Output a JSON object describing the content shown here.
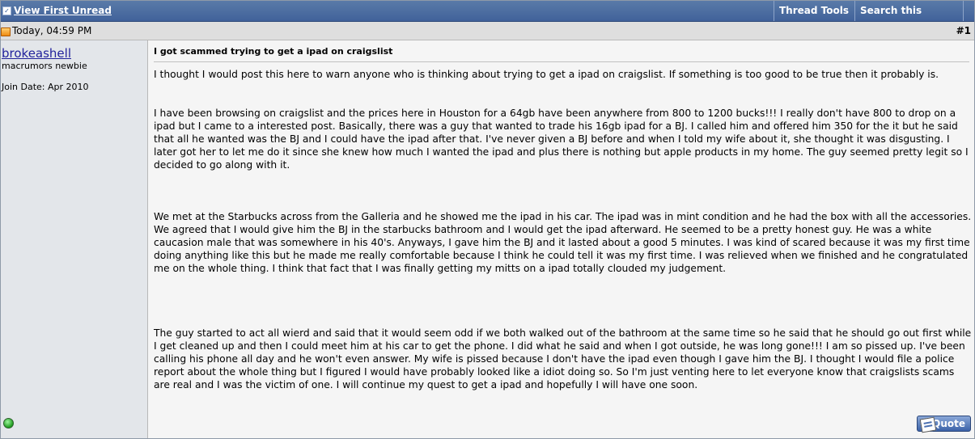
{
  "toolbar": {
    "view_first_unread": "View First Unread",
    "thread_tools": "Thread Tools",
    "search_thread": "Search this Thread"
  },
  "post_header": {
    "date": "Today, 04:59 PM",
    "post_number": "#1"
  },
  "user": {
    "username": "brokeashell",
    "title": "macrumors newbie",
    "join_date": "Join Date: Apr 2010"
  },
  "post": {
    "title": "I got scammed trying to get a ipad on craigslist",
    "paragraphs": [
      "I thought I would post this here to warn anyone who is thinking about trying to get a ipad on craigslist. If something is too good to be true then it probably is.",
      "I have been browsing on craigslist and the prices here in Houston for a 64gb have been anywhere from 800 to 1200 bucks!!! I really don't have 800 to drop on a ipad but I came to a interested post. Basically, there was a guy that wanted to trade his 16gb ipad for a BJ. I called him and offered him 350 for the it but he said that all he wanted was the BJ and I could have the ipad after that. I've never given a BJ before and when I told my wife about it, she thought it was disgusting. I later got her to let me do it since she knew how much I wanted the ipad and plus there is nothing but apple products in my home. The guy seemed pretty legit so I decided to go along with it.",
      "We met at the Starbucks across from the Galleria and he showed me the ipad in his car. The ipad was in mint condition and he had the box with all the accessories. We agreed that I would give him the BJ in the starbucks bathroom and I would get the ipad afterward. He seemed to be a pretty honest guy. He was a white caucasion male that was somewhere in his 40's. Anyways, I gave him the BJ and it lasted about a good 5 minutes. I was kind of scared because it was my first time doing anything like this but he made me really comfortable because I think he could tell it was my first time. I was relieved when we finished and he congratulated me on the whole thing. I think that fact that I was finally getting my mitts on a ipad totally clouded my judgement.",
      "The guy started to act all wierd and said that it would seem odd if we both walked out of the bathroom at the same time so he said that he should go out first while I get cleaned up and then I could meet him at his car to get the phone. I did what he said and when I got outside, he was long gone!!! I am so pissed up. I've been calling his phone all day and he won't even answer. My wife is pissed because I don't have the ipad even though I gave him the BJ. I thought I would file a police report about the whole thing but I figured I would have probably looked like a idiot doing so. So I'm just venting here to let everyone know that craigslists scams are real and I was the victim of one. I will continue my quest to get a ipad and hopefully I will have one soon."
    ],
    "quote_label": "Quote"
  },
  "colors": {
    "toolbar": "#4a6aa0",
    "date_row": "#dedede",
    "user_column": "#e3e6ea",
    "post_bg": "#f5f5f5",
    "username_link": "#22229c"
  }
}
